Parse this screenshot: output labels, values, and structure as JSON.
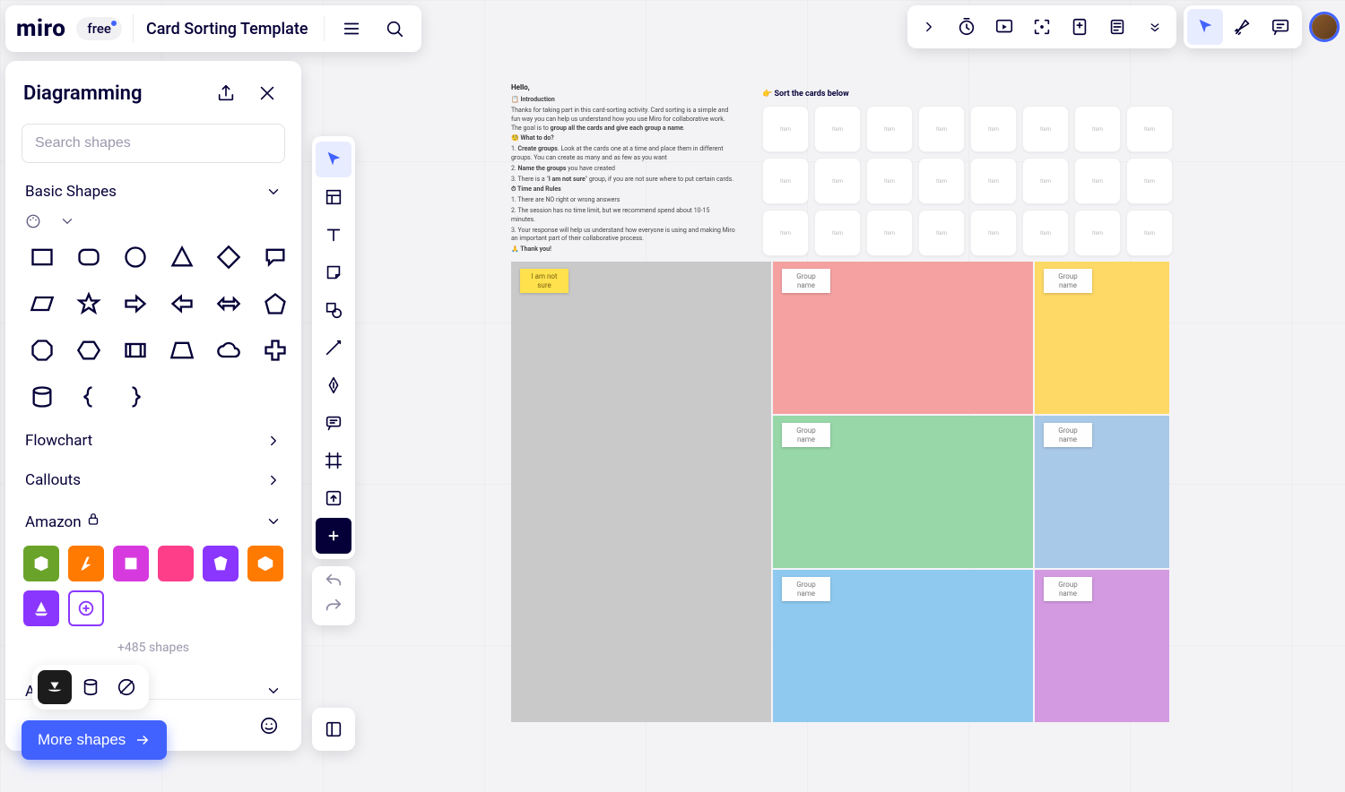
{
  "header": {
    "logo": "miro",
    "plan_chip": "free",
    "board_title": "Card Sorting Template"
  },
  "shape_panel": {
    "title": "Diagramming",
    "search_placeholder": "Search shapes",
    "sections": {
      "basic": {
        "label": "Basic Shapes"
      },
      "apply_colors": "Apply colors",
      "flowchart": {
        "label": "Flowchart"
      },
      "callouts": {
        "label": "Callouts"
      },
      "amazon": {
        "label": "Amazon",
        "more": "+485 shapes"
      },
      "azure": {
        "label": "Azure"
      }
    },
    "more_button": "More shapes"
  },
  "board": {
    "intro": {
      "hello": "Hello,",
      "h1": "📋 Introduction",
      "p1a": "Thanks for taking part in this card-sorting activity. Card sorting is a simple and fun way you can help us understand how you use Miro for collaborative work. The goal is to ",
      "p1b": "group all the cards and give each group a name",
      "p1c": ".",
      "h2": "🧐 What to do?",
      "l1a": "1. ",
      "l1b": "Create groups",
      "l1c": ". Look at the cards one at a time and place them in different groups. You can create as many and as few as you want",
      "l2a": "2. ",
      "l2b": "Name the groups",
      "l2c": " you have created",
      "l3a": "3. There is a \"",
      "l3b": "I am not sure",
      "l3c": "\" group, if you are not sure where to put certain cards.",
      "h3": "⏱ Time and Rules",
      "r1": "1. There are NO right or wrong answers",
      "r2": "2. The session has no time limit, but we recommend spend about 10-15 minutes.",
      "r3": "3. Your response will help us understand how everyone is using and making Miro an important part of their collaborative process.",
      "thanks": "🙏 Thank you!"
    },
    "sort_title": "👉 Sort the cards below",
    "card_placeholder": "Item",
    "groups": {
      "g1": "Group name",
      "g2": "Group name",
      "g3": "Group name",
      "g4": "Group name",
      "g5": "Group name",
      "g6": "Group name",
      "not_sure": "I am not sure"
    }
  }
}
